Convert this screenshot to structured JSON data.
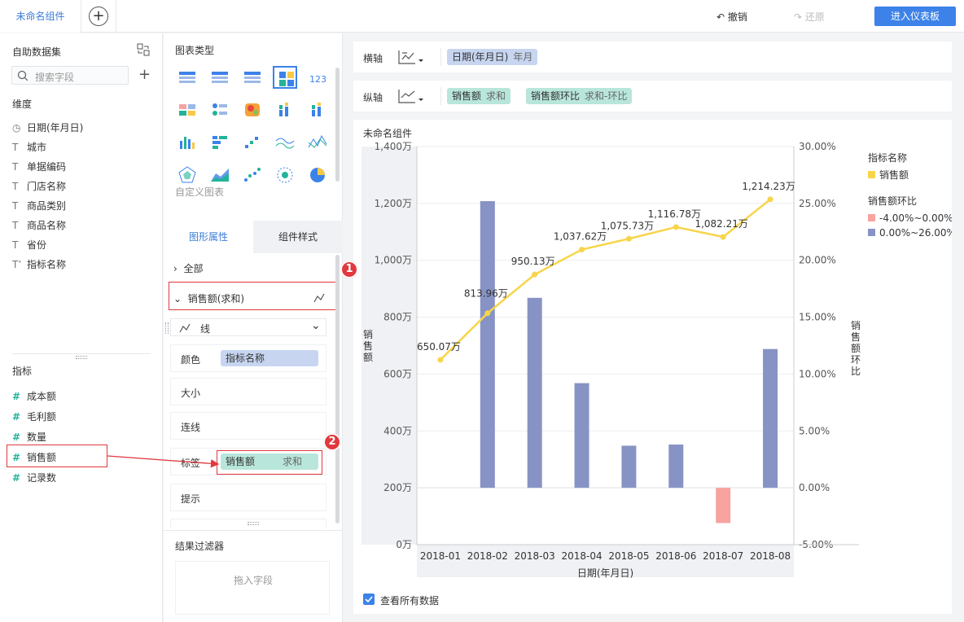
{
  "topbar": {
    "tab_label": "未命名组件",
    "undo_label": "撤销",
    "redo_label": "还原",
    "enter_label": "进入仪表板"
  },
  "dataset": {
    "title": "自助数据集",
    "search_placeholder": "搜索字段",
    "dimension_title": "维度",
    "dimensions": [
      {
        "icon": "clock-icon",
        "label": "日期(年月日)"
      },
      {
        "icon": "text-icon",
        "label": "城市"
      },
      {
        "icon": "text-icon",
        "label": "单据编码"
      },
      {
        "icon": "text-icon",
        "label": "门店名称"
      },
      {
        "icon": "text-icon",
        "label": "商品类别"
      },
      {
        "icon": "text-icon",
        "label": "商品名称"
      },
      {
        "icon": "text-icon",
        "label": "省份"
      },
      {
        "icon": "text-icon",
        "label": "指标名称"
      }
    ],
    "measure_title": "指标",
    "measures": [
      "成本额",
      "毛利额",
      "数量",
      "销售额",
      "记录数"
    ]
  },
  "config": {
    "chart_type_title": "图表类型",
    "custom_chart_label": "自定义图表",
    "tab_shape": "图形属性",
    "tab_style": "组件样式",
    "all_label": "全部",
    "series_label": "销售额(求和)",
    "line_label": "线",
    "color_label": "颜色",
    "color_field": "指标名称",
    "size_label": "大小",
    "connect_label": "连线",
    "tag_label": "标签",
    "tag_field": "销售额",
    "tag_agg": "求和",
    "tip_label": "提示",
    "filter_title": "结果过滤器",
    "filter_placeholder": "拖入字段"
  },
  "axes_cfg": {
    "x_label": "横轴",
    "x_field": "日期(年月日)",
    "x_sub": "年月",
    "y_label": "纵轴",
    "y_field1": "销售额",
    "y_sub1": "求和",
    "y_field2": "销售额环比",
    "y_sub2": "求和-环比"
  },
  "markers": [
    "1",
    "2"
  ],
  "chart_panel": {
    "title": "未命名组件",
    "show_all_label": "查看所有数据"
  },
  "legend": {
    "title1": "指标名称",
    "item1": "销售额",
    "title2": "销售额环比",
    "item2": "-4.00%~0.00%",
    "item3": "0.00%~26.00%"
  },
  "chart_data": {
    "type": "bar",
    "categories": [
      "2018-01",
      "2018-02",
      "2018-03",
      "2018-04",
      "2018-05",
      "2018-06",
      "2018-07",
      "2018-08"
    ],
    "xlabel": "日期(年月日)",
    "ylabel": "销售额",
    "y2label": "销售额环比",
    "ylim": [
      0,
      1400
    ],
    "y2lim": [
      -5,
      30
    ],
    "yticks": [
      "0万",
      "200万",
      "400万",
      "600万",
      "800万",
      "1,000万",
      "1,200万",
      "1,400万"
    ],
    "y2ticks": [
      "-5.00%",
      "0.00%",
      "5.00%",
      "10.00%",
      "15.00%",
      "20.00%",
      "25.00%",
      "30.00%"
    ],
    "line_series": {
      "name": "销售额",
      "values": [
        650.07,
        813.96,
        950.13,
        1037.62,
        1075.73,
        1116.78,
        1082.21,
        1214.23
      ],
      "labels": [
        "650.07万",
        "813.96万",
        "950.13万",
        "1,037.62万",
        "1,075.73万",
        "1,116.78万",
        "1,082.21万",
        "1,214.23万"
      ]
    },
    "bar_series": {
      "name": "销售额环比",
      "values": [
        null,
        25.2,
        16.7,
        9.2,
        3.7,
        3.8,
        -3.1,
        12.2
      ]
    },
    "colors": {
      "line": "#f7d54a",
      "bar_pos": "#8793c4",
      "bar_neg": "#f7a3a0"
    }
  }
}
